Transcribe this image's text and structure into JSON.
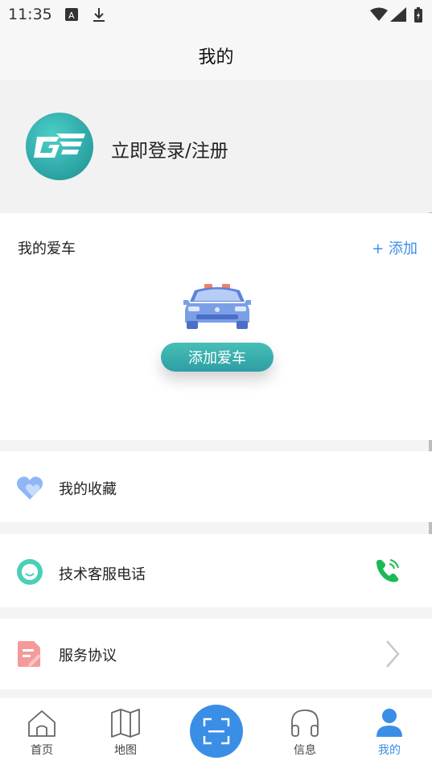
{
  "status_bar": {
    "time": "11:35"
  },
  "header": {
    "title": "我的"
  },
  "profile": {
    "login_label": "立即登录/注册"
  },
  "car_card": {
    "title": "我的爱车",
    "add_link": "+ 添加",
    "add_car_button": "添加爱车"
  },
  "menu": [
    {
      "label": "我的收藏",
      "icon": "heart-icon"
    },
    {
      "label": "技术客服电话",
      "icon": "chat-icon",
      "right_icon": "phone-icon"
    },
    {
      "label": "服务协议",
      "icon": "document-icon",
      "right_icon": "chevron-right-icon"
    }
  ],
  "tabbar": {
    "items": [
      {
        "label": "首页",
        "icon": "home-icon"
      },
      {
        "label": "地图",
        "icon": "map-icon"
      },
      {
        "label": "",
        "icon": "scan-icon"
      },
      {
        "label": "信息",
        "icon": "headphones-icon"
      },
      {
        "label": "我的",
        "icon": "person-icon",
        "active": true
      }
    ]
  },
  "colors": {
    "accent": "#3a8ee6",
    "teal": "#2fa8a8",
    "phone_green": "#1db954"
  }
}
